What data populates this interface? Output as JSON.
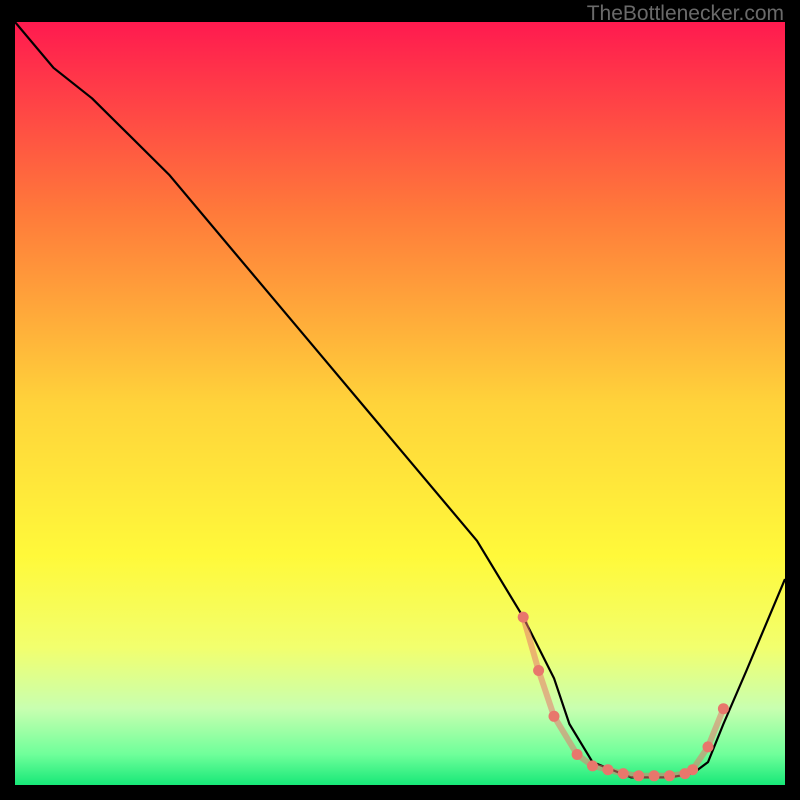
{
  "watermark": "TheBottlenecker.com",
  "chart_data": {
    "type": "line",
    "title": "",
    "xlabel": "",
    "ylabel": "",
    "xlim": [
      0,
      100
    ],
    "ylim": [
      0,
      100
    ],
    "gradient_stops": [
      {
        "offset": 0,
        "color": "#ff1a4f"
      },
      {
        "offset": 25,
        "color": "#ff7a3a"
      },
      {
        "offset": 50,
        "color": "#ffd33a"
      },
      {
        "offset": 70,
        "color": "#fff93a"
      },
      {
        "offset": 82,
        "color": "#f2ff6e"
      },
      {
        "offset": 90,
        "color": "#c8ffb0"
      },
      {
        "offset": 96,
        "color": "#6fff9a"
      },
      {
        "offset": 100,
        "color": "#17e878"
      }
    ],
    "series": [
      {
        "name": "curve",
        "stroke": "#000000",
        "x": [
          0,
          5,
          10,
          20,
          30,
          40,
          50,
          60,
          66,
          70,
          72,
          75,
          80,
          85,
          88,
          90,
          92,
          95,
          100
        ],
        "y": [
          100,
          94,
          90,
          80,
          68,
          56,
          44,
          32,
          22,
          14,
          8,
          3,
          1,
          1,
          1.5,
          3,
          8,
          15,
          27
        ]
      }
    ],
    "markers": {
      "color": "#e8776c",
      "points_x": [
        66,
        68,
        70,
        73,
        75,
        77,
        79,
        81,
        83,
        85,
        87,
        88,
        90,
        92
      ],
      "points_y": [
        22,
        15,
        9,
        4,
        2.5,
        2,
        1.5,
        1.2,
        1.2,
        1.2,
        1.5,
        2,
        5,
        10
      ]
    }
  }
}
